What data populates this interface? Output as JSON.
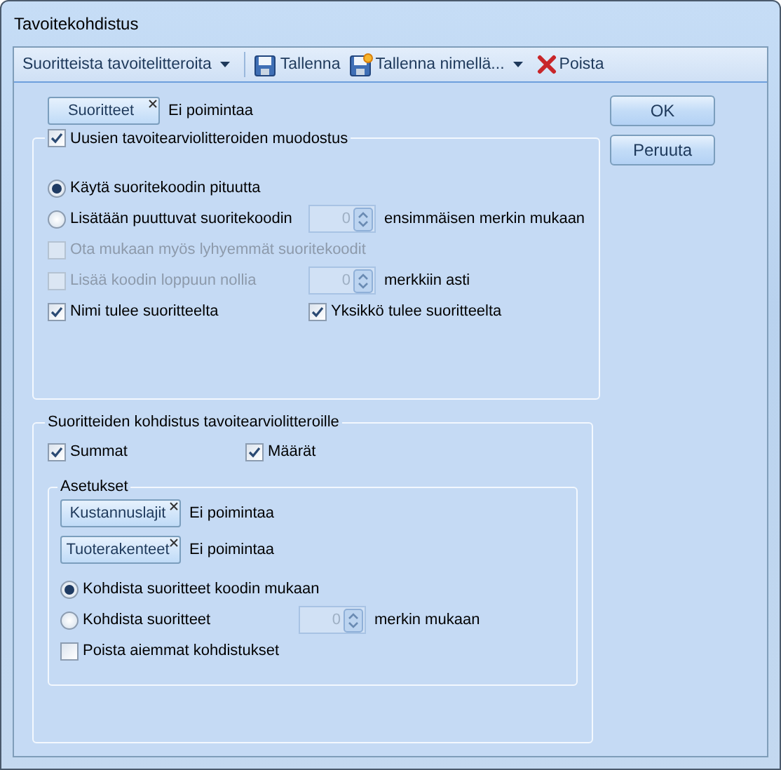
{
  "window": {
    "title": "Tavoitekohdistus"
  },
  "toolbar": [
    {
      "kind": "dropdown",
      "label": "Suoritteista tavoitelitteroita"
    },
    {
      "kind": "save",
      "label": "Tallenna"
    },
    {
      "kind": "save-as",
      "label": "Tallenna nimellä..."
    },
    {
      "kind": "delete",
      "label": "Poista"
    }
  ],
  "filter": {
    "label": "Suoritteet",
    "status": "Ei poimintaa"
  },
  "group_1": {
    "title": "Uusien tavoitearviolitteroiden muodostus",
    "checked": true,
    "rows": [
      {
        "kind": "radio",
        "label": "Käytä suoritekoodin pituutta",
        "selected": true,
        "disabled": false
      },
      {
        "kind": "radio",
        "label": "Lisätään puuttuvat suoritekoodin",
        "selected": false,
        "disabled": false,
        "spin": {
          "value": "0",
          "disabled": true
        },
        "suffix": "ensimmäisen merkin mukaan"
      },
      {
        "kind": "checkbox",
        "label": "Ota mukaan myös lyhyemmät suoritekoodit",
        "checked": false,
        "disabled": true
      },
      {
        "kind": "checkbox",
        "label": "Lisää koodin loppuun nollia",
        "checked": false,
        "disabled": true,
        "spin": {
          "value": "0",
          "disabled": true
        },
        "suffix": "merkkiin asti"
      },
      {
        "kind": "pair",
        "items": [
          {
            "label": "Nimi tulee suoritteelta",
            "checked": true
          },
          {
            "label": "Yksikkö tulee suoritteelta",
            "checked": true
          }
        ]
      }
    ]
  },
  "group_2": {
    "title": "Suoritteiden kohdistus tavoitearviolitteroille",
    "checks": [
      {
        "label": "Summat",
        "checked": true
      },
      {
        "label": "Määrät",
        "checked": true
      }
    ],
    "settings": {
      "title": "Asetukset",
      "filters": [
        {
          "label": "Kustannuslajit",
          "status": "Ei poimintaa"
        },
        {
          "label": "Tuoterakenteet",
          "status": "Ei poimintaa"
        }
      ],
      "rows": [
        {
          "kind": "radio",
          "label": "Kohdista suoritteet koodin mukaan",
          "selected": true,
          "disabled": false
        },
        {
          "kind": "radio",
          "label": "Kohdista suoritteet",
          "selected": false,
          "disabled": false,
          "spin": {
            "value": "0",
            "disabled": true
          },
          "suffix": "merkin mukaan"
        },
        {
          "kind": "checkbox",
          "label": "Poista aiemmat kohdistukset",
          "checked": false,
          "disabled": false
        }
      ]
    }
  },
  "buttons": [
    "OK",
    "Peruuta"
  ]
}
